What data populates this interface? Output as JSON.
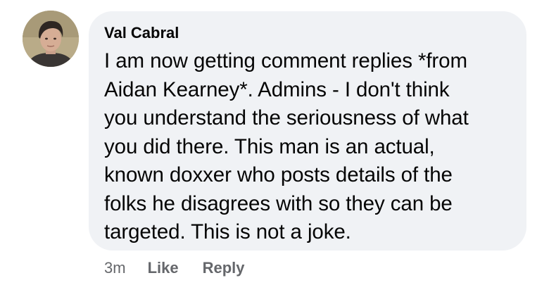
{
  "comment": {
    "author": "Val Cabral",
    "lines": [
      "I am now getting comment replies *from",
      "Aidan Kearney*. Admins - I don't think",
      "you understand the seriousness of what",
      "you did there. This man is an actual,",
      "known doxxer who posts details of the",
      "folks he disagrees with so they can be",
      "targeted. This is not a joke."
    ],
    "timestamp": "3m",
    "like_label": "Like",
    "reply_label": "Reply"
  },
  "colors": {
    "bubble_bg": "#f0f2f5",
    "text": "#050505",
    "meta": "#65676b"
  },
  "icons": {
    "avatar": "user-avatar-photo"
  }
}
